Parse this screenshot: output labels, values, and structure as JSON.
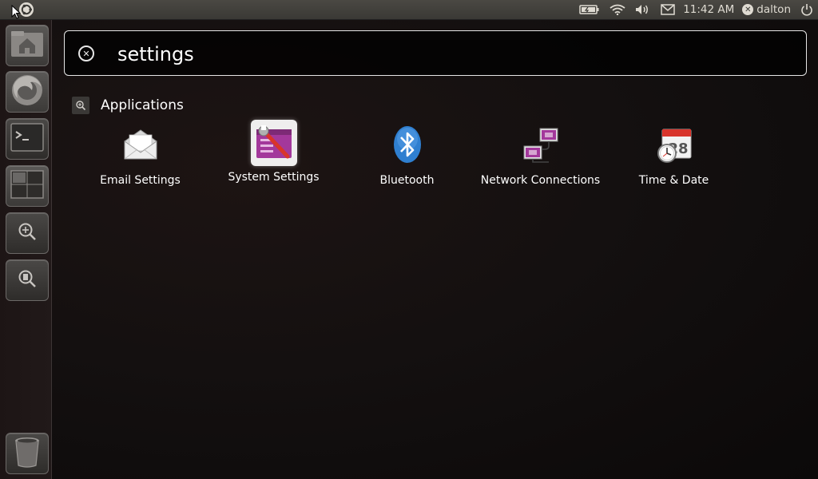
{
  "top_panel": {
    "clock": "11:42 AM",
    "user": "dalton",
    "icons": [
      "ubuntu-logo-icon",
      "battery-icon",
      "wifi-icon",
      "volume-icon",
      "mail-icon",
      "user-session-icon",
      "power-icon"
    ]
  },
  "launcher": {
    "items": [
      {
        "name": "home-folder-icon"
      },
      {
        "name": "firefox-icon"
      },
      {
        "name": "terminal-icon"
      },
      {
        "name": "workspace-switcher-icon"
      },
      {
        "name": "applications-lens-icon"
      },
      {
        "name": "files-lens-icon"
      },
      {
        "name": "trash-icon"
      }
    ]
  },
  "search": {
    "query": "settings"
  },
  "category": {
    "label": "Applications"
  },
  "results": [
    {
      "label": "Email Settings"
    },
    {
      "label": "System Settings"
    },
    {
      "label": "Bluetooth"
    },
    {
      "label": "Network Connections"
    },
    {
      "label": "Time & Date"
    }
  ],
  "calendar_day": "28",
  "colors": {
    "accent_purple": "#a3389b",
    "bluetooth_blue": "#2f7fd0",
    "calendar_red": "#d8342b"
  }
}
